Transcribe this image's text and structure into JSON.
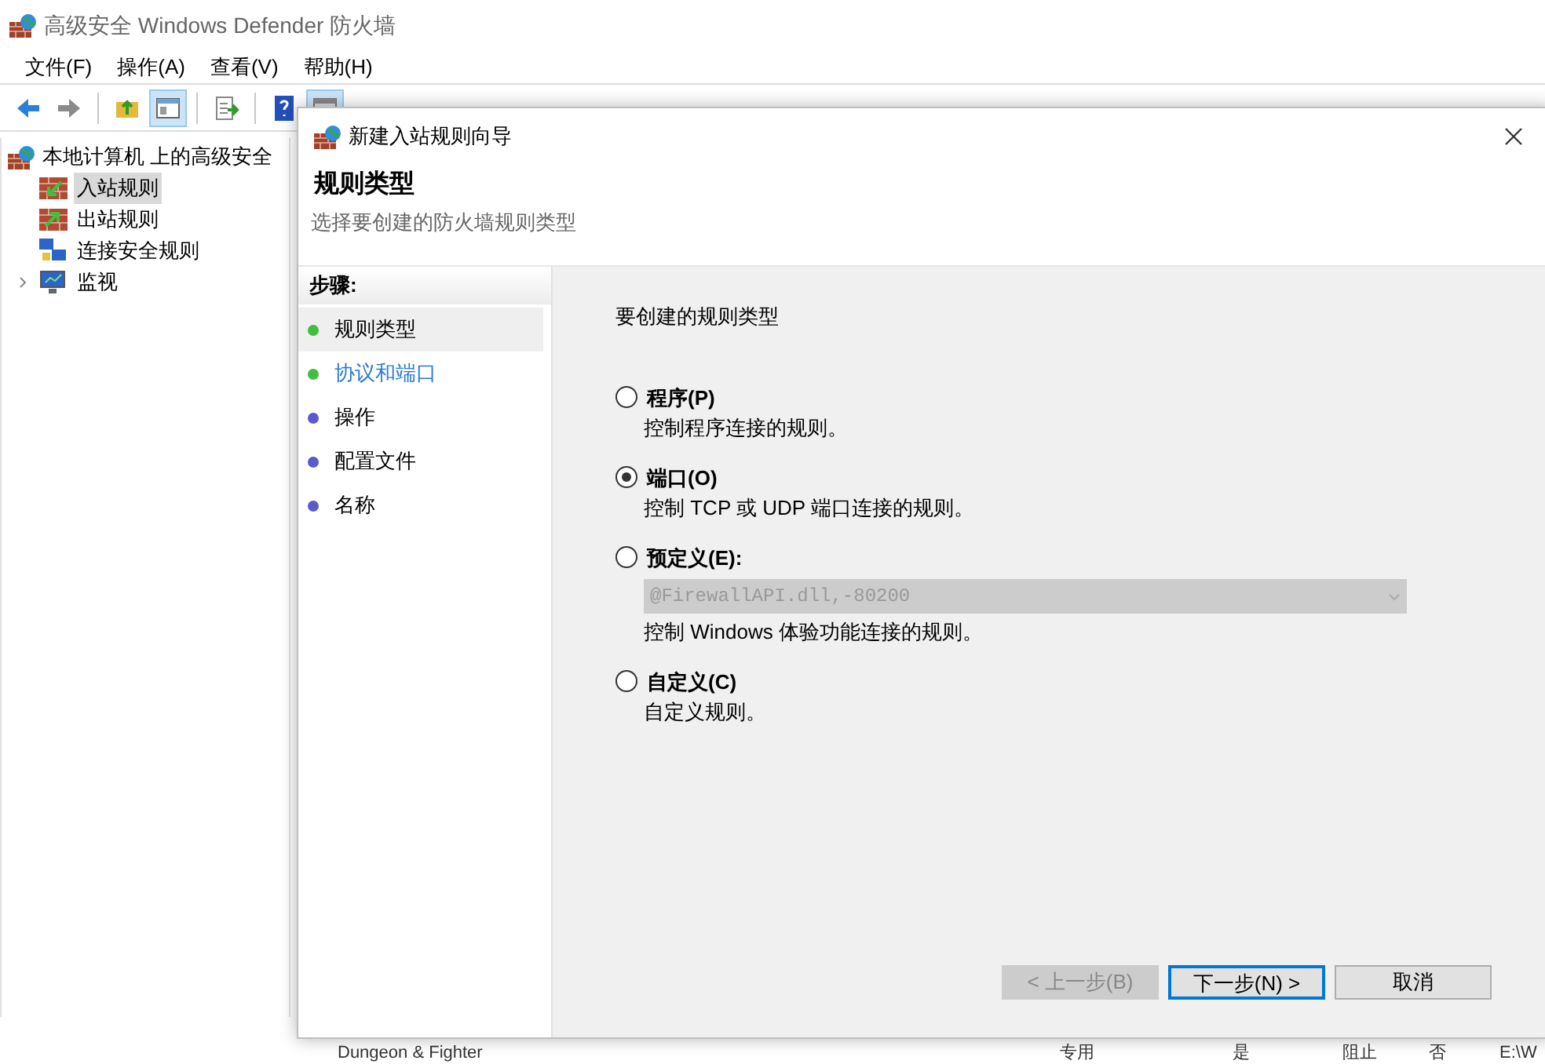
{
  "window": {
    "title": "高级安全 Windows Defender 防火墙"
  },
  "menu": [
    {
      "label": "文件(F)"
    },
    {
      "label": "操作(A)"
    },
    {
      "label": "查看(V)"
    },
    {
      "label": "帮助(H)"
    }
  ],
  "toolbar": [
    [
      {
        "kind": "back",
        "selected": false
      },
      {
        "kind": "forward",
        "selected": false
      }
    ],
    [
      {
        "kind": "up",
        "selected": false
      },
      {
        "kind": "pane",
        "selected": true
      }
    ],
    [
      {
        "kind": "export",
        "selected": false
      }
    ],
    [
      {
        "kind": "help",
        "selected": false
      },
      {
        "kind": "view",
        "selected": true
      }
    ]
  ],
  "tree": {
    "label": "本地计算机 上的高级安全",
    "children": [
      {
        "label": "入站规则",
        "kind": "inbound",
        "selected": true,
        "expandable": false
      },
      {
        "label": "出站规则",
        "kind": "outbound",
        "selected": false,
        "expandable": false
      },
      {
        "label": "连接安全规则",
        "kind": "connection",
        "selected": false,
        "expandable": false
      },
      {
        "label": "监视",
        "kind": "monitor",
        "selected": false,
        "expandable": true
      }
    ]
  },
  "rules_list": {
    "row": [
      "Dungeon & Fighter",
      "专用",
      "是",
      "阻止",
      "否",
      "E:\\W"
    ]
  },
  "dialog": {
    "title": "新建入站规则向导",
    "heading": "规则类型",
    "subtitle": "选择要创建的防火墙规则类型",
    "steps_header": "步骤:",
    "steps": [
      {
        "label": "规则类型",
        "selected": true,
        "highlighted": false,
        "color": "#3fbf3f"
      },
      {
        "label": "协议和端口",
        "selected": false,
        "highlighted": true,
        "color": "#3fbf3f"
      },
      {
        "label": "操作",
        "selected": false,
        "highlighted": false,
        "color": "#5a5acf"
      },
      {
        "label": "配置文件",
        "selected": false,
        "highlighted": false,
        "color": "#5a5acf"
      },
      {
        "label": "名称",
        "selected": false,
        "highlighted": false,
        "color": "#5a5acf"
      }
    ],
    "prompt": "要创建的规则类型",
    "options": [
      {
        "label": "程序(P)",
        "description": "控制程序连接的规则。",
        "selected": false
      },
      {
        "label": "端口(O)",
        "description": "控制 TCP 或 UDP 端口连接的规则。",
        "selected": true
      },
      {
        "label": "预定义(E):",
        "dropdown": {
          "value": "@FirewallAPI.dll,-80200",
          "disabled": true
        },
        "description": "控制 Windows 体验功能连接的规则。",
        "selected": false
      },
      {
        "label": "自定义(C)",
        "description": "自定义规则。",
        "selected": false
      }
    ],
    "buttons": [
      {
        "label": "< 上一步(B)",
        "disabled": true,
        "focused": false
      },
      {
        "label": "下一步(N) >",
        "disabled": false,
        "focused": true
      },
      {
        "label": "取消",
        "disabled": false,
        "focused": false
      }
    ]
  }
}
